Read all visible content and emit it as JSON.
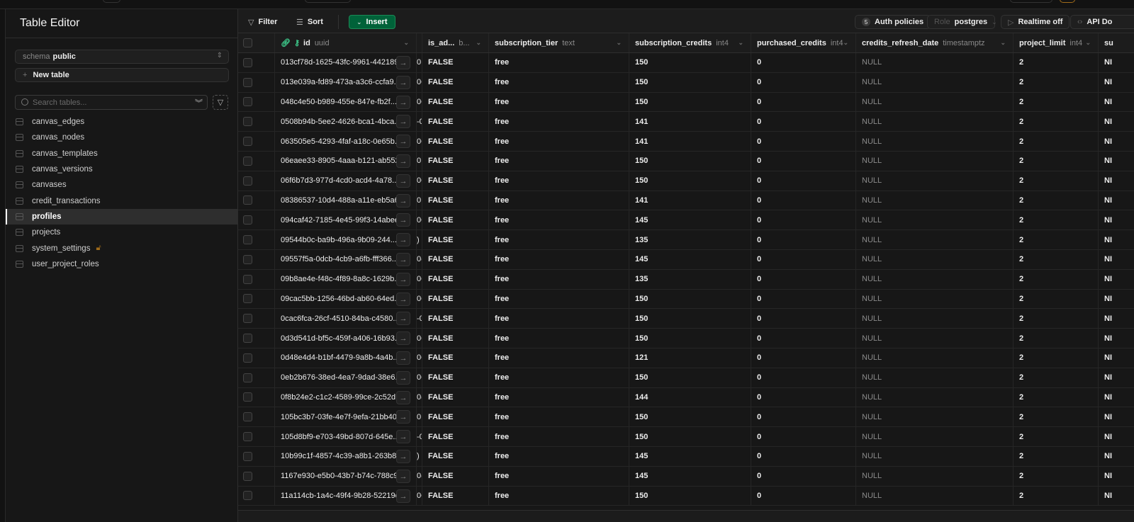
{
  "sidebar": {
    "title": "Table Editor",
    "schema_label": "schema",
    "schema_value": "public",
    "new_table": "New table",
    "search_placeholder": "Search tables...",
    "tables": [
      "canvas_edges",
      "canvas_nodes",
      "canvas_templates",
      "canvas_versions",
      "canvases",
      "credit_transactions",
      "profiles",
      "projects",
      "system_settings",
      "user_project_roles"
    ],
    "active_table": "profiles",
    "locked_table": "system_settings"
  },
  "toolbar": {
    "filter": "Filter",
    "sort": "Sort",
    "insert": "Insert",
    "auth_count": "5",
    "auth_policies": "Auth policies",
    "role_label": "Role",
    "role_value": "postgres",
    "realtime": "Realtime off",
    "api_docs": "API Do"
  },
  "colors": {
    "accent": "#006239",
    "lock": "#a06b1a",
    "key": "#3ecf8e"
  },
  "columns": [
    {
      "name": "id",
      "type": "uuid"
    },
    {
      "name": "",
      "type": ""
    },
    {
      "name": "is_ad...",
      "type": "b..."
    },
    {
      "name": "subscription_tier",
      "type": "text"
    },
    {
      "name": "subscription_credits",
      "type": "int4"
    },
    {
      "name": "purchased_credits",
      "type": "int4"
    },
    {
      "name": "credits_refresh_date",
      "type": "timestamptz"
    },
    {
      "name": "project_limit",
      "type": "int4"
    },
    {
      "name": "su",
      "type": ""
    }
  ],
  "rows": [
    [
      "013cf78d-1625-43fc-9961-442189...",
      "0",
      "FALSE",
      "free",
      "150",
      "0",
      "NULL",
      "2",
      "NI"
    ],
    [
      "013e039a-fd89-473a-a3c6-ccfa9...",
      "0C",
      "FALSE",
      "free",
      "150",
      "0",
      "NULL",
      "2",
      "NI"
    ],
    [
      "048c4e50-b989-455e-847e-fb2f...",
      "0C",
      "FALSE",
      "free",
      "150",
      "0",
      "NULL",
      "2",
      "NI"
    ],
    [
      "0508b94b-5ee2-4626-bca1-4bca...",
      "-0",
      "FALSE",
      "free",
      "141",
      "0",
      "NULL",
      "2",
      "NI"
    ],
    [
      "063505e5-4293-4faf-a18c-0e65b...",
      "0C",
      "FALSE",
      "free",
      "141",
      "0",
      "NULL",
      "2",
      "NI"
    ],
    [
      "06eaee33-8905-4aaa-b121-ab552...",
      "0",
      "FALSE",
      "free",
      "150",
      "0",
      "NULL",
      "2",
      "NI"
    ],
    [
      "06f6b7d3-977d-4cd0-acd4-4a78...",
      "0C",
      "FALSE",
      "free",
      "150",
      "0",
      "NULL",
      "2",
      "NI"
    ],
    [
      "08386537-10d4-488a-a11e-eb5a6...",
      "0",
      "FALSE",
      "free",
      "141",
      "0",
      "NULL",
      "2",
      "NI"
    ],
    [
      "094caf42-7185-4e45-99f3-14abee...",
      "0C",
      "FALSE",
      "free",
      "145",
      "0",
      "NULL",
      "2",
      "NI"
    ],
    [
      "09544b0c-ba9b-496a-9b09-244...",
      ")",
      "FALSE",
      "free",
      "135",
      "0",
      "NULL",
      "2",
      "NI"
    ],
    [
      "09557f5a-0dcb-4cb9-a6fb-fff366...",
      "0(",
      "FALSE",
      "free",
      "145",
      "0",
      "NULL",
      "2",
      "NI"
    ],
    [
      "09b8ae4e-f48c-4f89-8a8c-1629b...",
      "0C",
      "FALSE",
      "free",
      "135",
      "0",
      "NULL",
      "2",
      "NI"
    ],
    [
      "09cac5bb-1256-46bd-ab60-64ed...",
      "0C",
      "FALSE",
      "free",
      "150",
      "0",
      "NULL",
      "2",
      "NI"
    ],
    [
      "0cac6fca-26cf-4510-84ba-c4580...",
      "-0",
      "FALSE",
      "free",
      "150",
      "0",
      "NULL",
      "2",
      "NI"
    ],
    [
      "0d3d541d-bf5c-459f-a406-16b93...",
      "0C",
      "FALSE",
      "free",
      "150",
      "0",
      "NULL",
      "2",
      "NI"
    ],
    [
      "0d48e4d4-b1bf-4479-9a8b-4a4b...",
      "0C",
      "FALSE",
      "free",
      "121",
      "0",
      "NULL",
      "2",
      "NI"
    ],
    [
      "0eb2b676-38ed-4ea7-9dad-38e6...",
      "0C",
      "FALSE",
      "free",
      "150",
      "0",
      "NULL",
      "2",
      "NI"
    ],
    [
      "0f8b24e2-c1c2-4589-99ce-2c52d...",
      "0(",
      "FALSE",
      "free",
      "144",
      "0",
      "NULL",
      "2",
      "NI"
    ],
    [
      "105bc3b7-03fe-4e7f-9efa-21bb40...",
      "0",
      "FALSE",
      "free",
      "150",
      "0",
      "NULL",
      "2",
      "NI"
    ],
    [
      "105d8bf9-e703-49bd-807d-645e...",
      "-0",
      "FALSE",
      "free",
      "150",
      "0",
      "NULL",
      "2",
      "NI"
    ],
    [
      "10b99c1f-4857-4c39-a8b1-263b8...",
      ")",
      "FALSE",
      "free",
      "145",
      "0",
      "NULL",
      "2",
      "NI"
    ],
    [
      "1167e930-e5b0-43b7-b74c-788c9...",
      "0(",
      "FALSE",
      "free",
      "145",
      "0",
      "NULL",
      "2",
      "NI"
    ],
    [
      "11a114cb-1a4c-49f4-9b28-52219ec...",
      "0C",
      "FALSE",
      "free",
      "150",
      "0",
      "NULL",
      "2",
      "NI"
    ]
  ]
}
